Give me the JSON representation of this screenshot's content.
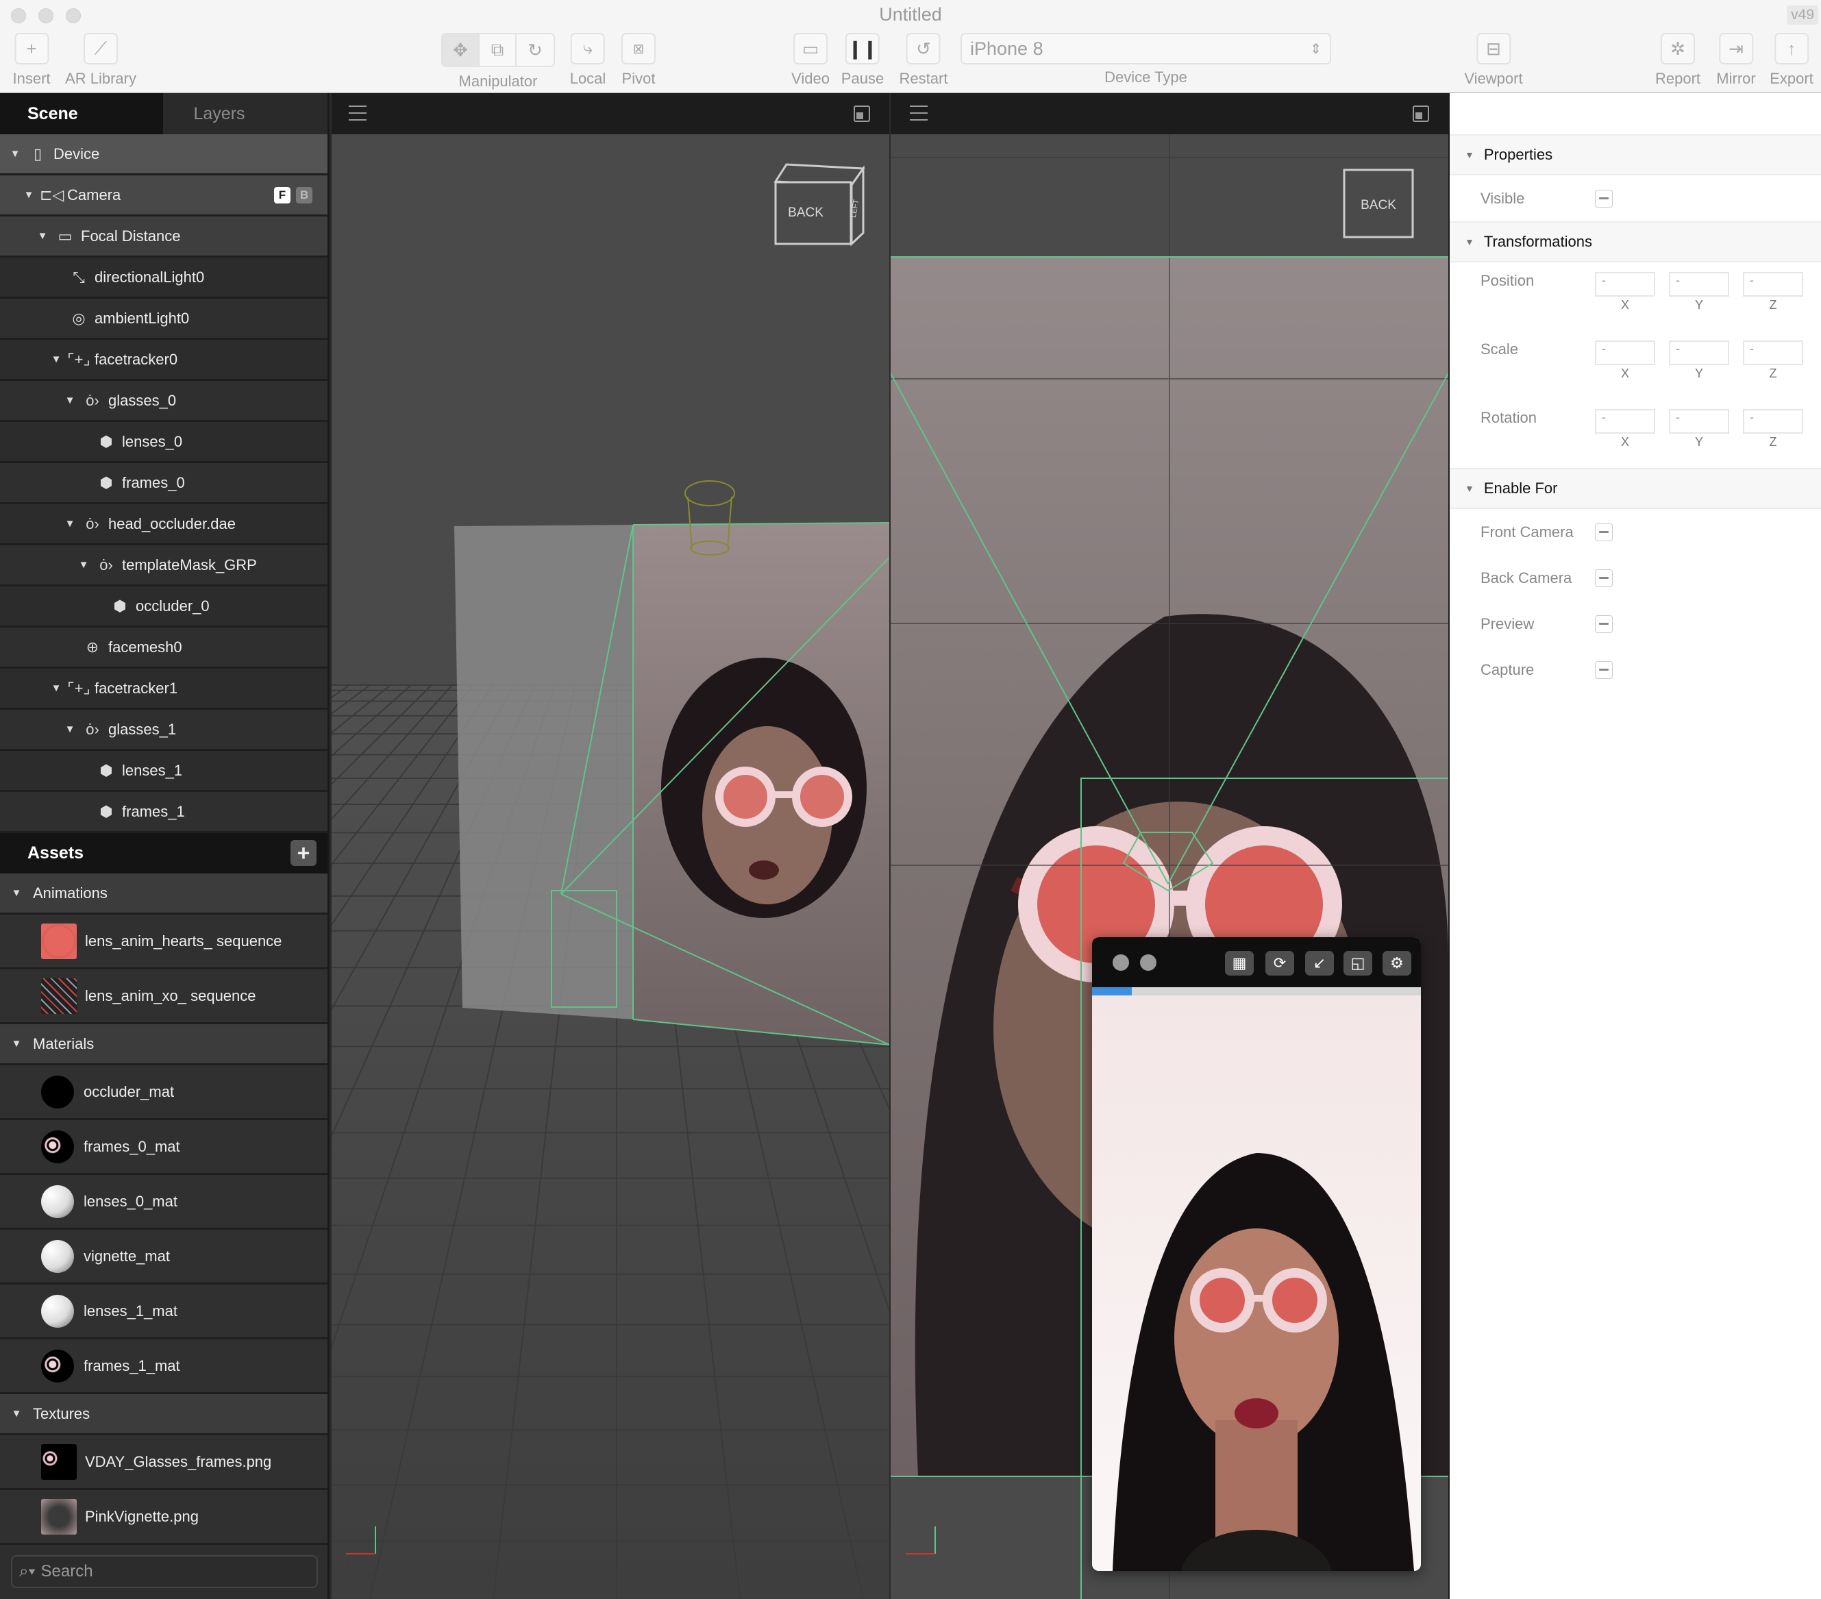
{
  "window": {
    "title": "Untitled",
    "version": "v49"
  },
  "toolbar": {
    "insert": "Insert",
    "ar_library": "AR Library",
    "manipulator": "Manipulator",
    "local": "Local",
    "pivot": "Pivot",
    "video": "Video",
    "pause": "Pause",
    "restart": "Restart",
    "device_type_value": "iPhone 8",
    "device_type_label": "Device Type",
    "viewport": "Viewport",
    "report": "Report",
    "mirror": "Mirror",
    "export": "Export"
  },
  "scene_panel": {
    "tabs": [
      {
        "label": "Scene",
        "active": true
      },
      {
        "label": "Layers",
        "active": false
      }
    ],
    "tree": [
      {
        "label": "Device",
        "level": 0,
        "expanded": true,
        "icon": "device-icon"
      },
      {
        "label": "Camera",
        "level": 1,
        "expanded": true,
        "icon": "camera-icon",
        "badges": [
          "F",
          "B"
        ]
      },
      {
        "label": "Focal Distance",
        "level": 2,
        "expanded": true,
        "icon": "ruler-icon"
      },
      {
        "label": "directionalLight0",
        "level": 3,
        "icon": "directional-light-icon"
      },
      {
        "label": "ambientLight0",
        "level": 3,
        "icon": "ambient-light-icon"
      },
      {
        "label": "facetracker0",
        "level": 3,
        "expanded": true,
        "icon": "facetracker-icon"
      },
      {
        "label": "glasses_0",
        "level": 4,
        "expanded": true,
        "icon": "null-object-icon"
      },
      {
        "label": "lenses_0",
        "level": 5,
        "icon": "mesh-icon"
      },
      {
        "label": "frames_0",
        "level": 5,
        "icon": "mesh-icon"
      },
      {
        "label": "head_occluder.dae",
        "level": 4,
        "expanded": true,
        "icon": "null-object-icon"
      },
      {
        "label": "templateMask_GRP",
        "level": 5,
        "expanded": true,
        "icon": "null-object-icon"
      },
      {
        "label": "occluder_0",
        "level": 6,
        "icon": "mesh-icon"
      },
      {
        "label": "facemesh0",
        "level": 4,
        "icon": "facemesh-icon"
      },
      {
        "label": "facetracker1",
        "level": 3,
        "expanded": true,
        "icon": "facetracker-icon"
      },
      {
        "label": "glasses_1",
        "level": 4,
        "expanded": true,
        "icon": "null-object-icon"
      },
      {
        "label": "lenses_1",
        "level": 5,
        "icon": "mesh-icon"
      },
      {
        "label": "frames_1",
        "level": 5,
        "icon": "mesh-icon"
      }
    ]
  },
  "assets": {
    "title": "Assets",
    "sections": [
      {
        "label": "Animations",
        "items": [
          {
            "label": "lens_anim_hearts_ sequence",
            "thumb": "red-lens"
          },
          {
            "label": "lens_anim_xo_ sequence",
            "thumb": "xo-grid"
          }
        ]
      },
      {
        "label": "Materials",
        "items": [
          {
            "label": "occluder_mat",
            "thumb": "black-sphere"
          },
          {
            "label": "frames_0_mat",
            "thumb": "glasses-sphere"
          },
          {
            "label": "lenses_0_mat",
            "thumb": "white-sphere"
          },
          {
            "label": "vignette_mat",
            "thumb": "white-sphere"
          },
          {
            "label": "lenses_1_mat",
            "thumb": "white-sphere"
          },
          {
            "label": "frames_1_mat",
            "thumb": "glasses-sphere"
          }
        ]
      },
      {
        "label": "Textures",
        "items": [
          {
            "label": "VDAY_Glasses_frames.png",
            "thumb": "glasses-texture"
          },
          {
            "label": "PinkVignette.png",
            "thumb": "vignette-texture"
          }
        ]
      }
    ],
    "search_placeholder": "Search"
  },
  "viewport": {
    "cube_front": "BACK",
    "cube_side": "LEFT",
    "camera_view_label": "BACK"
  },
  "properties": {
    "sections": {
      "properties": "Properties",
      "transformations": "Transformations",
      "enable_for": "Enable For"
    },
    "visible": "Visible",
    "transforms": [
      {
        "label": "Position",
        "x": "-",
        "y": "-",
        "z": "-"
      },
      {
        "label": "Scale",
        "x": "-",
        "y": "-",
        "z": "-"
      },
      {
        "label": "Rotation",
        "x": "-",
        "y": "-",
        "z": "-"
      }
    ],
    "axes": [
      "X",
      "Y",
      "Z"
    ],
    "enable_for": [
      "Front Camera",
      "Back Camera",
      "Preview",
      "Capture"
    ]
  },
  "preview": {
    "progress_percent": 12,
    "accent": "#3d8fe0"
  },
  "colors": {
    "lens": "#e0615a",
    "frame": "#f0d0d4",
    "guide": "#5fc48a"
  }
}
